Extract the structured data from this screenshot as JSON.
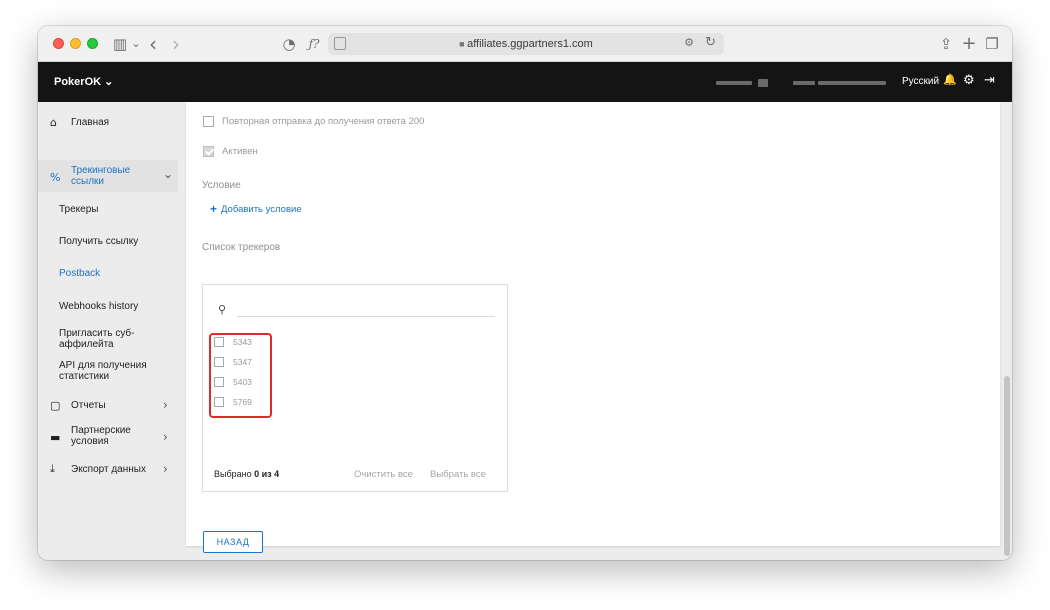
{
  "browser": {
    "url": "affiliates.ggpartners1.com",
    "back_glyph": "‹",
    "forward_glyph": "›",
    "function_glyph": "ƒ?",
    "translate_glyph": "⚙",
    "reload_glyph": "↻",
    "share_glyph": "⇪",
    "new_tab_glyph": "+",
    "tabs_glyph": "❐",
    "sidebar_glyph": "▥",
    "chevron_glyph": "⌄",
    "lock_glyph": "🔒",
    "shield_glyph": "◔"
  },
  "header": {
    "brand": "PokerOK ⌄",
    "language": "Русский",
    "bell_glyph": "🔔",
    "gear_glyph": "⚙",
    "logout_glyph": "⇥"
  },
  "sidebar": {
    "home": {
      "label": "Главная",
      "icon": "home-icon",
      "glyph": "⌂"
    },
    "tracking": {
      "label_line1": "Трекинговые",
      "label_line2": "ссылки",
      "icon": "link-icon",
      "glyph": "%",
      "chevron": "⌄"
    },
    "sub_items": [
      {
        "label": "Трекеры"
      },
      {
        "label": "Получить ссылку"
      },
      {
        "label": "Postback"
      },
      {
        "label": "Webhooks history"
      },
      {
        "label_line1": "Пригласить суб-",
        "label_line2": "аффилейта"
      },
      {
        "label_line1": "API для получения",
        "label_line2": "статистики"
      }
    ],
    "reports": {
      "label": "Отчеты",
      "icon": "reports-icon",
      "glyph": "▢",
      "chevron": "›"
    },
    "partner": {
      "label_line1": "Партнерские",
      "label_line2": "условия",
      "icon": "briefcase-icon",
      "glyph": "▬",
      "chevron": "›"
    },
    "export": {
      "label": "Экспорт данных",
      "icon": "download-icon",
      "glyph": "⤓",
      "chevron": "›"
    },
    "active_color": "#1a73c8"
  },
  "form": {
    "resend_label": "Повторная отправка до получения ответа 200",
    "resend_checked": false,
    "active_label": "Активен",
    "active_checked": true,
    "condition_title": "Условие",
    "add_condition_plus": "+",
    "add_condition_label": "Добавить условие",
    "tracker_list_title": "Список трекеров",
    "search_glyph": "⚲",
    "search_value": "",
    "trackers": [
      "5343",
      "5347",
      "5403",
      "5769"
    ],
    "selected_prefix": "Выбрано ",
    "selected_count": "0 из 4",
    "clear_all": "Очистить все",
    "select_all": "Выбрать все",
    "back_button": "НАЗАД"
  },
  "colors": {
    "link_blue": "#1a73c8",
    "highlight_red": "#e02b2b",
    "header_bg": "#141414"
  }
}
